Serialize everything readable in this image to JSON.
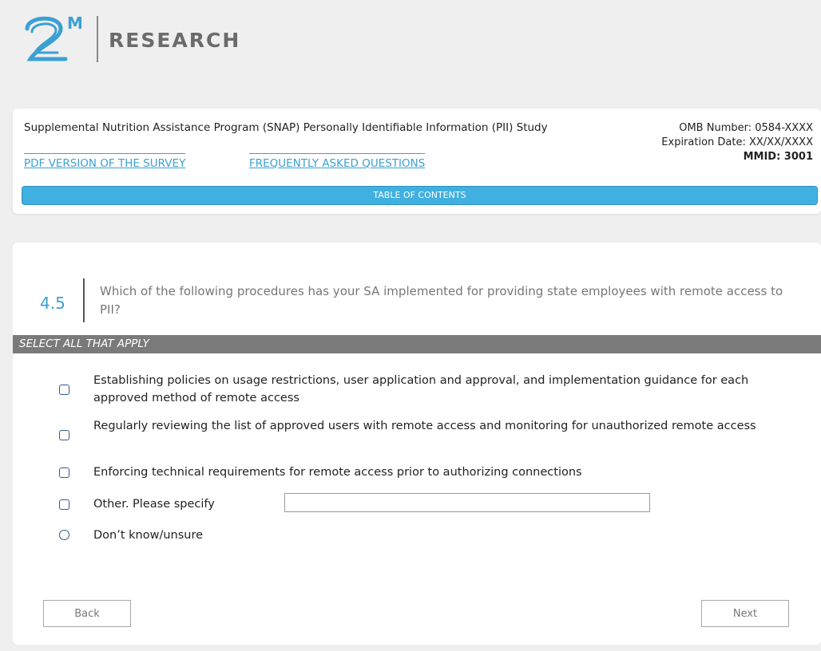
{
  "brand": {
    "logo_mark": "2M",
    "logo_text": "RESEARCH",
    "logo_color": "#3aa1d3"
  },
  "header": {
    "study_title": "Supplemental Nutrition Assistance Program (SNAP) Personally Identifiable Information (PII) Study",
    "omb_number": "OMB Number: 0584-XXXX",
    "expiration_date": "Expiration Date: XX/XX/XXXX",
    "mmid": "MMID: 3001",
    "pdf_link": "PDF VERSION OF THE SURVEY",
    "faq_link": "FREQUENTLY ASKED QUESTIONS",
    "toc_label": "TABLE OF CONTENTS"
  },
  "question": {
    "number": "4.5",
    "text": "Which of the following procedures has your SA implemented for providing state employees with remote access to PII?",
    "instruction": "SELECT ALL THAT APPLY",
    "options": [
      {
        "label": "Establishing policies on usage restrictions, user application and approval, and implementation guidance for each approved method of remote access",
        "type": "checkbox",
        "checked": false
      },
      {
        "label": "Regularly reviewing the list of approved users with remote access and monitoring for unauthorized remote access",
        "type": "checkbox",
        "checked": false
      },
      {
        "label": "Enforcing technical requirements for remote access prior to authorizing connections",
        "type": "checkbox",
        "checked": false
      },
      {
        "label": "Other. Please specify",
        "type": "checkbox",
        "checked": false,
        "has_text_input": true,
        "input_value": ""
      },
      {
        "label": "Don’t know/unsure",
        "type": "radio",
        "checked": false
      }
    ]
  },
  "nav": {
    "back_label": "Back",
    "next_label": "Next"
  }
}
